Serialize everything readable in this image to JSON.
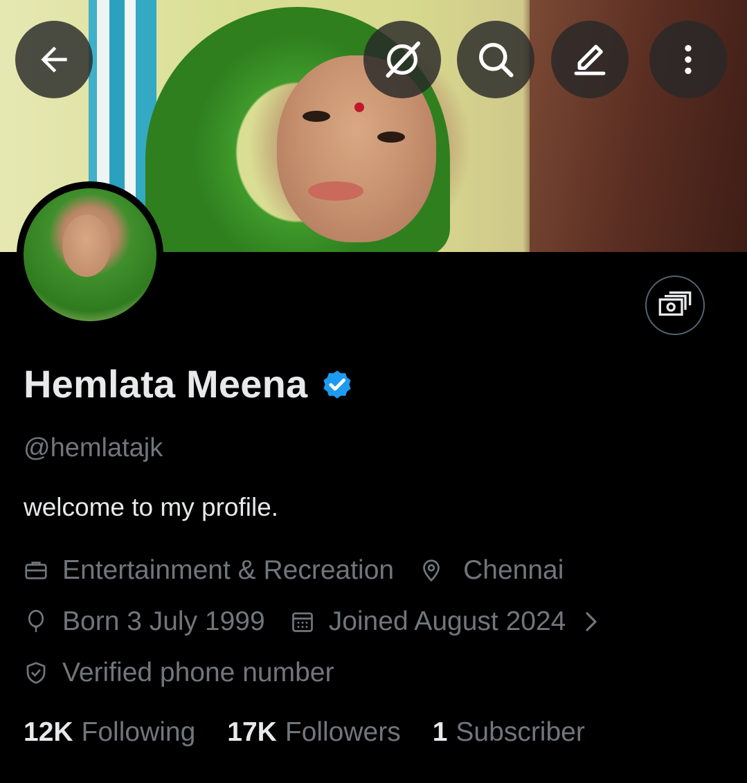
{
  "profile": {
    "name": "Hemlata Meena",
    "handle": "@hemlatajk",
    "bio": "welcome to my profile.",
    "verified_badge_color": "#1d9bf0"
  },
  "meta": {
    "category": "Entertainment & Recreation",
    "location": "Chennai",
    "born": "Born 3 July 1999",
    "joined": "Joined August 2024",
    "verified_phone": "Verified phone number"
  },
  "stats": {
    "following_count": "12K",
    "following_label": "Following",
    "followers_count": "17K",
    "followers_label": "Followers",
    "subscribers_count": "1",
    "subscribers_label": "Subscriber"
  },
  "toolbar": {
    "icons": [
      "back-arrow-icon",
      "grok-icon",
      "search-icon",
      "edit-icon",
      "more-vertical-icon"
    ]
  },
  "colors": {
    "background": "#000000",
    "text_primary": "#e7e9ea",
    "text_secondary": "#71767b",
    "accent": "#1d9bf0"
  }
}
